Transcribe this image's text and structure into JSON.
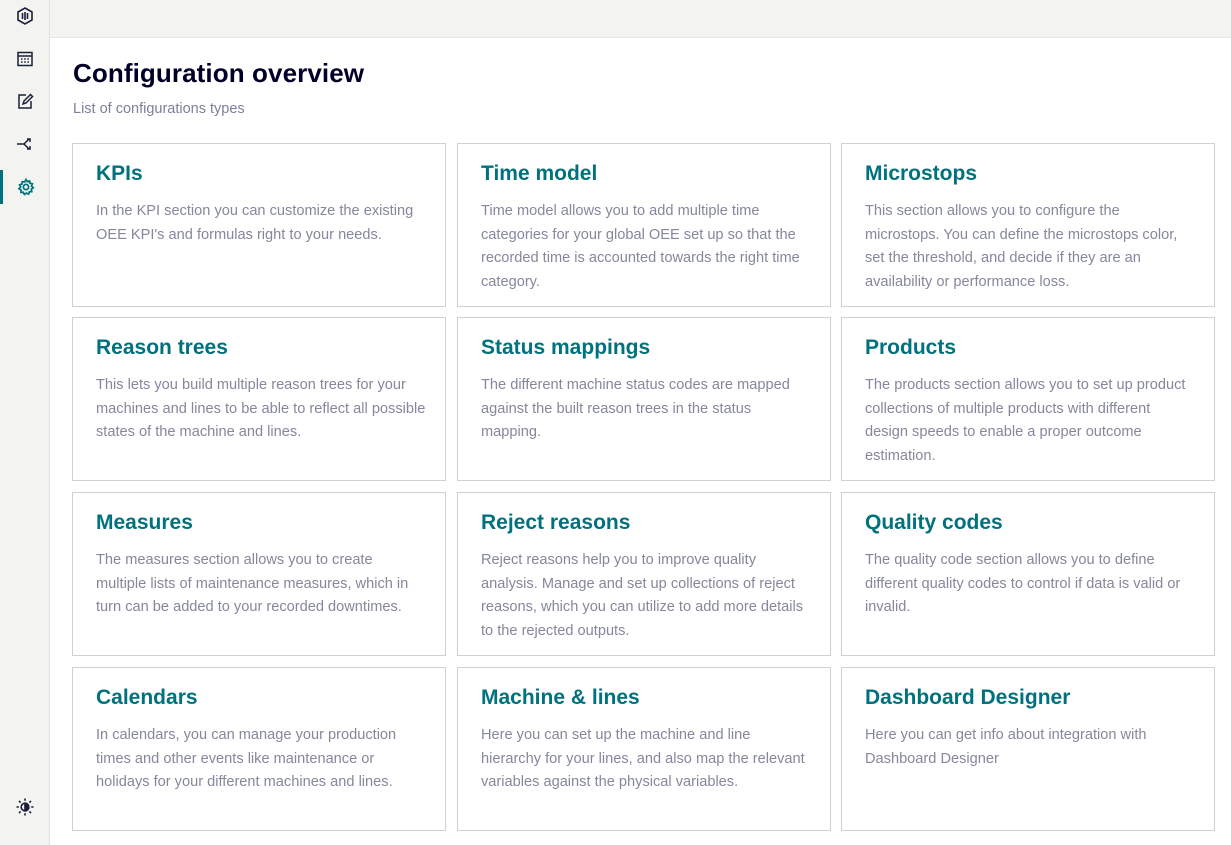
{
  "sidebar": {
    "items": [
      {
        "name": "app-logo-icon"
      },
      {
        "name": "calendar-icon"
      },
      {
        "name": "edit-icon"
      },
      {
        "name": "share-icon"
      },
      {
        "name": "settings-icon",
        "active": true
      }
    ],
    "bottom": {
      "name": "theme-toggle-icon"
    },
    "accent_color": "#00727e"
  },
  "page": {
    "title": "Configuration overview",
    "subtitle": "List of configurations types"
  },
  "cards": [
    {
      "title": "KPIs",
      "description": "In the KPI section you can customize the existing OEE KPI's and formulas right to your needs."
    },
    {
      "title": "Time model",
      "description": "Time model allows you to add multiple time categories for your global OEE set up so that the recorded time is accounted towards the right time category."
    },
    {
      "title": "Microstops",
      "description": "This section allows you to configure the microstops. You can define the microstops color, set the threshold, and decide if they are an availability or performance loss."
    },
    {
      "title": "Reason trees",
      "description": "This lets you build multiple reason trees for your machines and lines to be able to reflect all possible states of the machine and lines."
    },
    {
      "title": "Status mappings",
      "description": "The different machine status codes are mapped against the built reason trees in the status mapping."
    },
    {
      "title": "Products",
      "description": "The products section allows you to set up product collections of multiple products with different design speeds to enable a proper outcome estimation."
    },
    {
      "title": "Measures",
      "description": "The measures section allows you to create multiple lists of maintenance measures, which in turn can be added to your recorded downtimes."
    },
    {
      "title": "Reject reasons",
      "description": "Reject reasons help you to improve quality analysis. Manage and set up collections of reject reasons, which you can utilize to add more details to the rejected outputs."
    },
    {
      "title": "Quality codes",
      "description": "The quality code section allows you to define different quality codes to control if data is valid or invalid."
    },
    {
      "title": "Calendars",
      "description": "In calendars, you can manage your production times and other events like maintenance or holidays for your different machines and lines."
    },
    {
      "title": "Machine & lines",
      "description": "Here you can set up the machine and line hierarchy for your lines, and also map the relevant variables against the physical variables."
    },
    {
      "title": "Dashboard Designer",
      "description": "Here you can get info about integration with Dashboard Designer"
    }
  ]
}
